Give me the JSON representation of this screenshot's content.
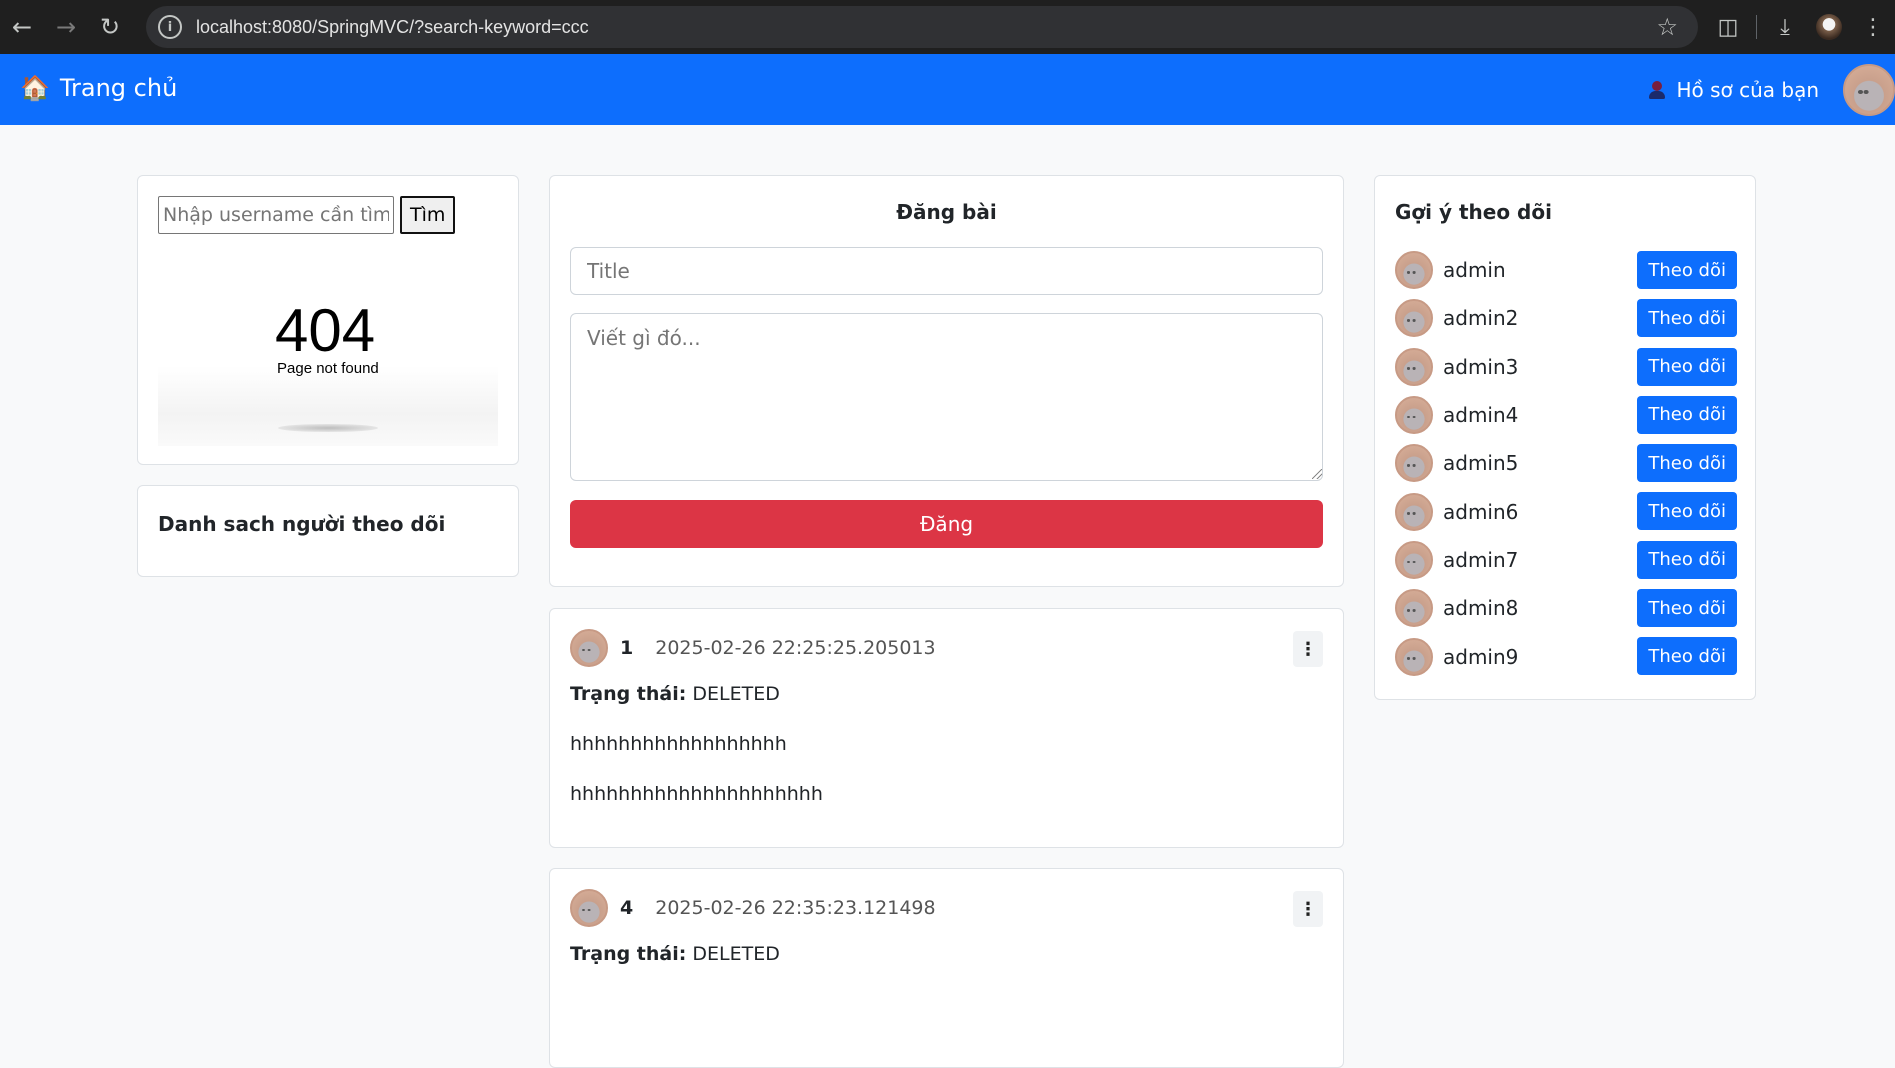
{
  "browser": {
    "url": "localhost:8080/SpringMVC/?search-keyword=ccc"
  },
  "navbar": {
    "brand": "Trang chủ",
    "profile_link": "Hồ sơ của bạn"
  },
  "search": {
    "placeholder": "Nhập username cần tìm...",
    "button": "Tìm",
    "error_code": "404",
    "error_text": "Page not found"
  },
  "followers": {
    "title": "Danh sach người theo dõi"
  },
  "composer": {
    "title": "Đăng bài",
    "title_placeholder": "Title",
    "content_placeholder": "Viết gì đó...",
    "submit": "Đăng"
  },
  "posts": [
    {
      "id": "1",
      "time": "2025-02-26 22:25:25.205013",
      "status_label": "Trạng thái:",
      "status": "DELETED",
      "title": "hhhhhhhhhhhhhhhhhh",
      "body": "hhhhhhhhhhhhhhhhhhhhh"
    },
    {
      "id": "4",
      "time": "2025-02-26 22:35:23.121498",
      "status_label": "Trạng thái:",
      "status": "DELETED"
    }
  ],
  "suggestions": {
    "title": "Gợi ý theo dõi",
    "follow_label": "Theo dõi",
    "users": [
      "admin",
      "admin2",
      "admin3",
      "admin4",
      "admin5",
      "admin6",
      "admin7",
      "admin8",
      "admin9"
    ]
  },
  "colors": {
    "primary": "#0d6efd",
    "danger": "#dc3545",
    "background": "#f8f9fa"
  }
}
